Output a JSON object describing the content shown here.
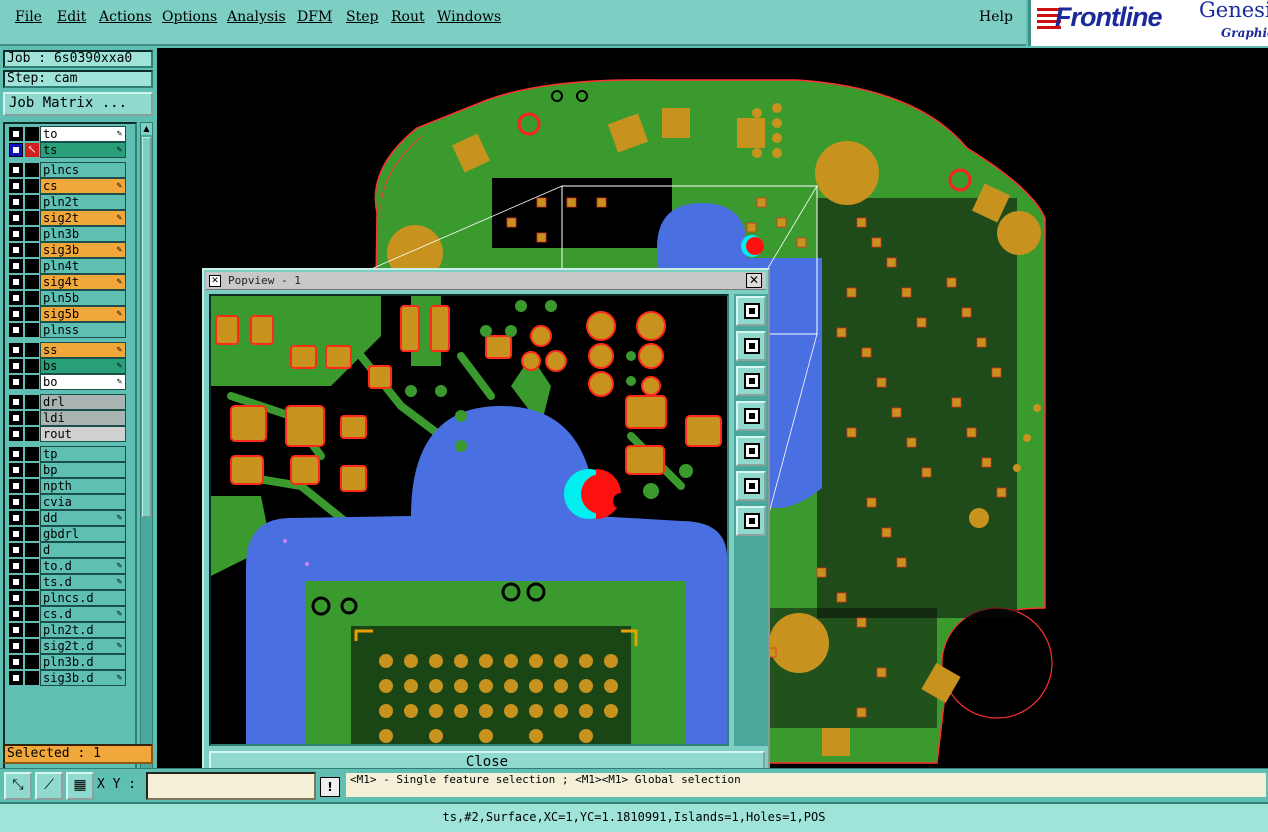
{
  "menu": {
    "items": [
      "File",
      "Edit",
      "Actions",
      "Options",
      "Analysis",
      "DFM",
      "Step",
      "Rout",
      "Windows"
    ],
    "help": "Help"
  },
  "brand": {
    "name": "Frontline",
    "product": "Genesis",
    "sub": "Graphic"
  },
  "job": {
    "job_label": "Job : 6s0390xxa0",
    "step_label": "Step: cam",
    "matrix_button": "Job Matrix ..."
  },
  "layers": [
    {
      "name": "to",
      "color": "#ffffff",
      "edit": true,
      "active": false
    },
    {
      "name": "ts",
      "color": "#2aa07a",
      "edit": true,
      "active": true
    },
    {
      "name": "plncs",
      "color": "#5fbfb2",
      "edit": false,
      "active": false
    },
    {
      "name": "cs",
      "color": "#f2a73a",
      "edit": true,
      "active": false
    },
    {
      "name": "pln2t",
      "color": "#5fbfb2",
      "edit": false,
      "active": false
    },
    {
      "name": "sig2t",
      "color": "#f2a73a",
      "edit": true,
      "active": false
    },
    {
      "name": "pln3b",
      "color": "#5fbfb2",
      "edit": false,
      "active": false
    },
    {
      "name": "sig3b",
      "color": "#f2a73a",
      "edit": true,
      "active": false
    },
    {
      "name": "pln4t",
      "color": "#5fbfb2",
      "edit": false,
      "active": false
    },
    {
      "name": "sig4t",
      "color": "#f2a73a",
      "edit": true,
      "active": false
    },
    {
      "name": "pln5b",
      "color": "#5fbfb2",
      "edit": false,
      "active": false
    },
    {
      "name": "sig5b",
      "color": "#f2a73a",
      "edit": true,
      "active": false
    },
    {
      "name": "plnss",
      "color": "#5fbfb2",
      "edit": false,
      "active": false
    },
    {
      "name": "ss",
      "color": "#f2a73a",
      "edit": true,
      "active": false
    },
    {
      "name": "bs",
      "color": "#2aa07a",
      "edit": true,
      "active": false
    },
    {
      "name": "bo",
      "color": "#ffffff",
      "edit": true,
      "active": false
    },
    {
      "name": "drl",
      "color": "#a9b3b1",
      "edit": false,
      "active": false
    },
    {
      "name": "ldi",
      "color": "#a9b3b1",
      "edit": false,
      "active": false
    },
    {
      "name": "rout",
      "color": "#d0d0d0",
      "edit": false,
      "active": false
    },
    {
      "name": "tp",
      "color": "#5fbfb2",
      "edit": false,
      "active": false
    },
    {
      "name": "bp",
      "color": "#5fbfb2",
      "edit": false,
      "active": false
    },
    {
      "name": "npth",
      "color": "#5fbfb2",
      "edit": false,
      "active": false
    },
    {
      "name": "cvia",
      "color": "#5fbfb2",
      "edit": false,
      "active": false
    },
    {
      "name": "dd",
      "color": "#5fbfb2",
      "edit": true,
      "active": false
    },
    {
      "name": "gbdrl",
      "color": "#5fbfb2",
      "edit": false,
      "active": false
    },
    {
      "name": "d",
      "color": "#5fbfb2",
      "edit": false,
      "active": false
    },
    {
      "name": "to.d",
      "color": "#5fbfb2",
      "edit": true,
      "active": false
    },
    {
      "name": "ts.d",
      "color": "#5fbfb2",
      "edit": true,
      "active": false
    },
    {
      "name": "plncs.d",
      "color": "#5fbfb2",
      "edit": false,
      "active": false
    },
    {
      "name": "cs.d",
      "color": "#5fbfb2",
      "edit": true,
      "active": false
    },
    {
      "name": "pln2t.d",
      "color": "#5fbfb2",
      "edit": false,
      "active": false
    },
    {
      "name": "sig2t.d",
      "color": "#5fbfb2",
      "edit": true,
      "active": false
    },
    {
      "name": "pln3b.d",
      "color": "#5fbfb2",
      "edit": false,
      "active": false
    },
    {
      "name": "sig3b.d",
      "color": "#5fbfb2",
      "edit": true,
      "active": false
    }
  ],
  "selected": "Selected : 1",
  "popview": {
    "title": "Popview - 1",
    "close_label": "Close"
  },
  "bottom": {
    "xy_label": "X Y :",
    "xy_value": "",
    "hint": "<M1> - Single feature selection ; <M1><M1> Global selection"
  },
  "status": "ts,#2,Surface,XC=1,YC=1.1810991,Islands=1,Holes=1,POS",
  "colors": {
    "ui_teal": "#5fbfb2",
    "board_green": "#3a9a2e",
    "pad_orange": "#c7921e",
    "surface_blue": "#4a6fe0",
    "highlight_red": "#ff1010",
    "highlight_cyan": "#00f0f0"
  }
}
